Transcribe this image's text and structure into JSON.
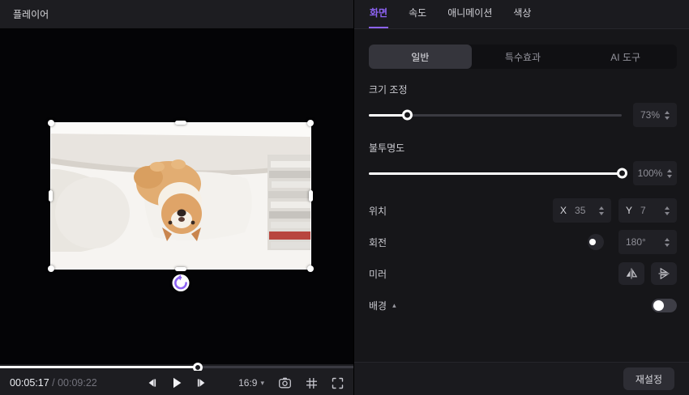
{
  "colors": {
    "accent": "#8d63f3",
    "slider_fill": "#ffffff",
    "panel_bg": "#161619"
  },
  "icons": {
    "dropdown_caret": "▾",
    "collapse_caret": "▴"
  },
  "player": {
    "title": "플레이어",
    "current_time": "00:05:17",
    "time_separator": " / ",
    "total_time": "00:09:22",
    "seek_percent": 56,
    "aspect_ratio": "16:9"
  },
  "inspector": {
    "tabs": [
      {
        "label": "화면",
        "active": true
      },
      {
        "label": "속도",
        "active": false
      },
      {
        "label": "애니메이션",
        "active": false
      },
      {
        "label": "색상",
        "active": false
      }
    ],
    "subtabs": [
      {
        "label": "일반",
        "active": true
      },
      {
        "label": "특수효과",
        "active": false
      },
      {
        "label": "AI 도구",
        "active": false
      }
    ],
    "scale": {
      "label": "크기 조정",
      "value": "73%",
      "percent": 15
    },
    "opacity": {
      "label": "불투명도",
      "value": "100%",
      "percent": 100
    },
    "position": {
      "label": "위치",
      "x_label": "X",
      "x_value": "35",
      "y_label": "Y",
      "y_value": "7"
    },
    "rotation": {
      "label": "회전",
      "value": "180°"
    },
    "mirror": {
      "label": "미러"
    },
    "background": {
      "label": "배경"
    },
    "reset_label": "재설정"
  }
}
